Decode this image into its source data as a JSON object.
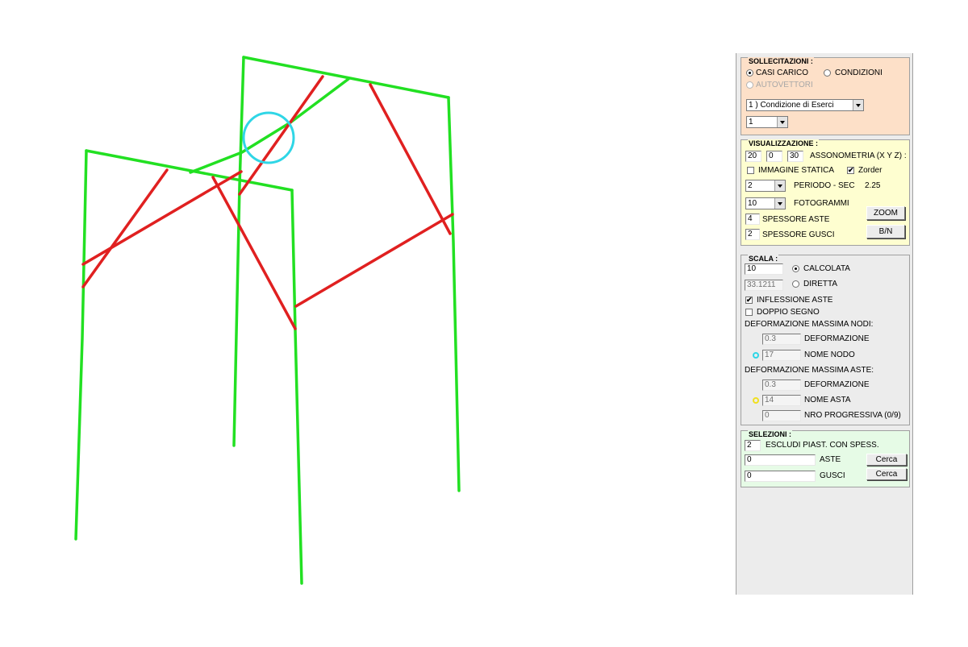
{
  "colors": {
    "frame": "#22e022",
    "brace": "#e02020",
    "highlight": "#2fd6e6",
    "node_marker": "#2fd6e6",
    "member_marker": "#f0e020",
    "sollecitazioni_bg": "#fde0c8",
    "visualizzazione_bg": "#fefed0",
    "scala_bg": "#ececec",
    "selezioni_bg": "#e6fbe6"
  },
  "sollecitazioni": {
    "title": "SOLLECITAZIONI :",
    "opt_casi": "CASI CARICO",
    "opt_condizioni": "CONDIZIONI",
    "opt_autovettori": "AUTOVETTORI",
    "selected": "CASI CARICO",
    "case_select": "1 ) Condizione di Eserci",
    "index_select": "1"
  },
  "visualizzazione": {
    "title": "VISUALIZZAZIONE :",
    "ax_x": "20",
    "ax_y": "0",
    "ax_z": "30",
    "asso_label": "ASSONOMETRIA (X Y Z) :",
    "immagine_label": "IMMAGINE STATICA",
    "immagine_checked": false,
    "zorder_label": "Zorder",
    "zorder_checked": true,
    "periodo_select": "2",
    "periodo_label": "PERIODO - SEC",
    "periodo_value": "2.25",
    "fotogrammi_select": "10",
    "fotogrammi_label": "FOTOGRAMMI",
    "spessore_aste": "4",
    "spessore_aste_label": "SPESSORE ASTE",
    "spessore_gusci": "2",
    "spessore_gusci_label": "SPESSORE GUSCI",
    "zoom_button": "ZOOM",
    "bn_button": "B/N"
  },
  "scala": {
    "title": "SCALA :",
    "calcolata_value": "10",
    "calcolata_label": "CALCOLATA",
    "diretta_value": "33.1211",
    "diretta_label": "DIRETTA",
    "selected": "CALCOLATA",
    "inflessione_label": "INFLESSIONE ASTE",
    "inflessione_checked": true,
    "doppio_label": "DOPPIO SEGNO",
    "doppio_checked": false,
    "nodi_heading": "DEFORMAZIONE MASSIMA NODI:",
    "nodi_def_value": "0.3",
    "nodi_def_label": "DEFORMAZIONE",
    "nodi_nome_value": "17",
    "nodi_nome_label": "NOME NODO",
    "aste_heading": "DEFORMAZIONE MASSIMA ASTE:",
    "aste_def_value": "0.3",
    "aste_def_label": "DEFORMAZIONE",
    "aste_nome_value": "14",
    "aste_nome_label": "NOME ASTA",
    "nro_value": "0",
    "nro_label": "NRO PROGRESSIVA (0/9)"
  },
  "selezioni": {
    "title": "SELEZIONI :",
    "escludi_value": "2",
    "escludi_label": "ESCLUDI PIAST. CON SPESS.",
    "aste_value": "0",
    "aste_label": "ASTE",
    "aste_button": "Cerca",
    "gusci_value": "0",
    "gusci_label": "GUSCI",
    "gusci_button": "Cerca"
  }
}
